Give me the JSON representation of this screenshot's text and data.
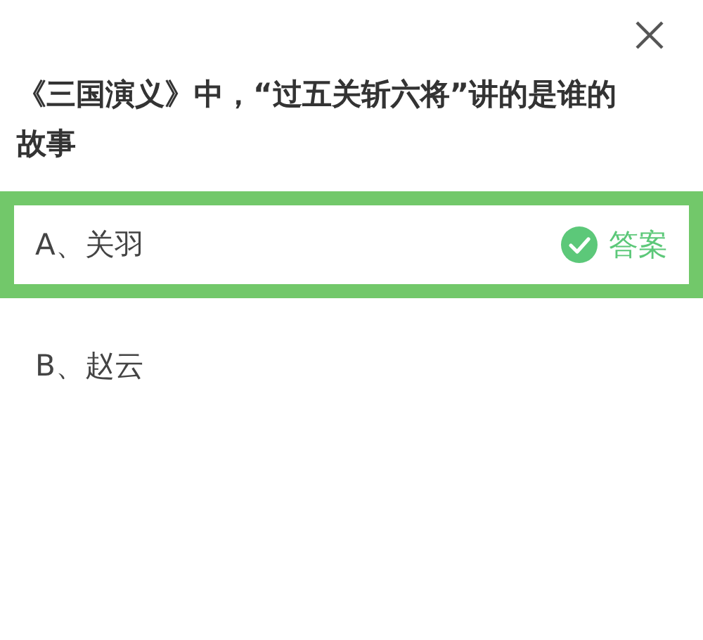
{
  "question": "《三国演义》中，“过五关斩六将”讲的是谁的故事",
  "options": [
    {
      "label": "A、关羽",
      "selected": true,
      "badge": "答案"
    },
    {
      "label": "B、赵云",
      "selected": false
    }
  ]
}
